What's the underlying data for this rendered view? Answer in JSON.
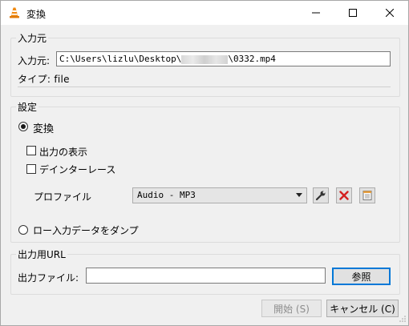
{
  "window": {
    "title": "変換"
  },
  "source": {
    "group_label": "入力元",
    "input_label": "入力元:",
    "path_prefix": "C:\\Users\\lizlu\\Desktop\\",
    "path_suffix": "\\0332.mp4",
    "type_text": "タイプ: file"
  },
  "settings": {
    "group_label": "設定",
    "convert_label": "変換",
    "convert_selected": true,
    "show_output_label": "出力の表示",
    "show_output_checked": false,
    "deinterlace_label": "デインターレース",
    "deinterlace_checked": false,
    "profile_label": "プロファイル",
    "profile_value": "Audio - MP3",
    "dump_label": "ロー入力データをダンプ",
    "dump_selected": false,
    "icons": [
      "wrench-icon",
      "delete-x-icon",
      "new-profile-icon"
    ],
    "accent_red": "#d42020"
  },
  "destination": {
    "group_label": "出力用URL",
    "file_label": "出力ファイル:",
    "file_value": "",
    "browse_label": "参照"
  },
  "footer": {
    "start_label": "開始 (S)",
    "cancel_label": "キャンセル (C)"
  }
}
